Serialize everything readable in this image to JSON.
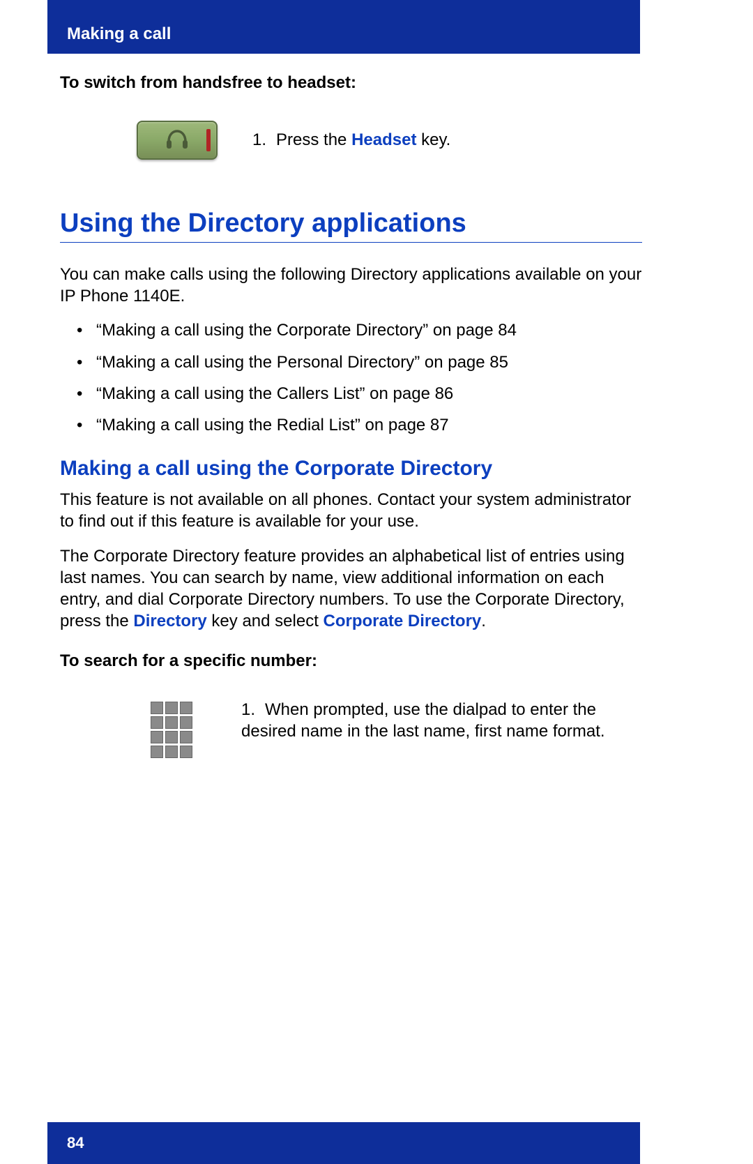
{
  "header": {
    "chapter": "Making a call"
  },
  "section1": {
    "instruction": "To switch from handsfree to headset:",
    "step_num": "1.",
    "step_prefix": "Press the ",
    "step_key": "Headset",
    "step_suffix": " key.",
    "button_icon": "headset-icon"
  },
  "h1": "Using the Directory applications",
  "intro": "You can make calls using the following Directory applications available on your IP Phone 1140E.",
  "bullets": [
    "“Making a call using the Corporate Directory” on page 84",
    "“Making a call using the Personal Directory” on page 85",
    "“Making a call using the Callers List” on page 86",
    "“Making a call using the Redial List” on page 87"
  ],
  "h2": "Making a call using the Corporate Directory",
  "para1": "This feature is not available on all phones. Contact your system administrator to find out if this feature is available for your use.",
  "para2": {
    "t1": "The Corporate Directory feature provides an alphabetical list of entries using last names. You can search by name, view additional information on each entry, and dial Corporate Directory numbers. To use the Corporate Directory, press the ",
    "k1": "Directory",
    "t2": " key and select ",
    "k2": "Corporate Directory",
    "t3": "."
  },
  "section2": {
    "instruction": "To search for a specific number:",
    "step_num": "1.",
    "step_text": "When prompted, use the dialpad to enter the desired name in the last name, first name format.",
    "icon": "dialpad-icon"
  },
  "footer": {
    "page": "84"
  }
}
